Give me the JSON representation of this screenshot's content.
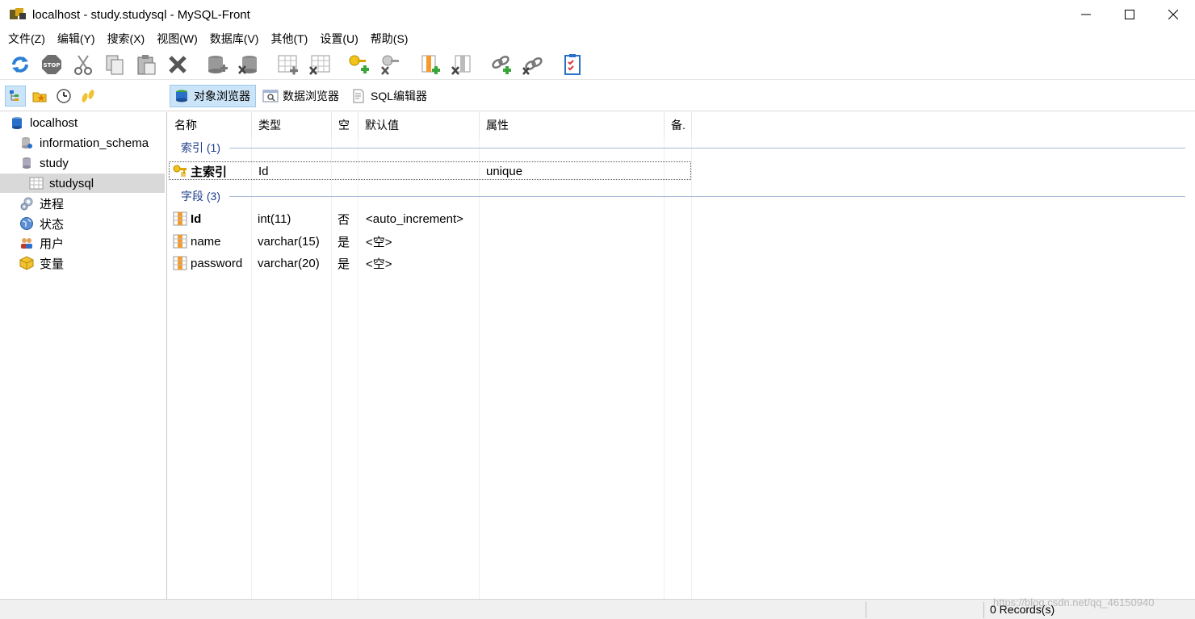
{
  "window": {
    "title": "localhost - study.studysql - MySQL-Front",
    "minimize": "—",
    "maximize": "☐",
    "close": "✕"
  },
  "menu": [
    "文件(Z)",
    "编辑(Y)",
    "搜索(X)",
    "视图(W)",
    "数据库(V)",
    "其他(T)",
    "设置(U)",
    "帮助(S)"
  ],
  "toolbar": {
    "icons": [
      "refresh-icon",
      "stop-icon",
      "cut-icon",
      "copy-icon",
      "paste-icon",
      "delete-icon",
      "new-database-icon",
      "delete-database-icon",
      "new-table-icon",
      "delete-table-icon",
      "new-index-icon",
      "delete-index-icon",
      "new-field-icon",
      "delete-field-icon",
      "new-foreign-key-icon",
      "delete-foreign-key-icon",
      "properties-icon"
    ]
  },
  "view_tabs": [
    "对象浏览器",
    "数据浏览器",
    "SQL编辑器"
  ],
  "tree": {
    "items": [
      "localhost",
      "information_schema",
      "study",
      "studysql",
      "进程",
      "状态",
      "用户",
      "变量"
    ]
  },
  "grid": {
    "headers": [
      "名称",
      "类型",
      "空",
      "默认值",
      "属性",
      "备."
    ],
    "index_group": "索引 (1)",
    "index_rows": [
      {
        "name": "主索引",
        "type": "Id",
        "null": "",
        "default": "",
        "attr": "unique"
      }
    ],
    "field_group": "字段 (3)",
    "field_rows": [
      {
        "name": "Id",
        "type": "int(11)",
        "null": "否",
        "default": "<auto_increment>"
      },
      {
        "name": "name",
        "type": "varchar(15)",
        "null": "是",
        "default": "<空>"
      },
      {
        "name": "password",
        "type": "varchar(20)",
        "null": "是",
        "default": "<空>"
      }
    ]
  },
  "status": {
    "records": "0 Records(s)",
    "watermark": "https://blog.csdn.net/qq_46150940"
  },
  "colors": {
    "accent": "#cce4f7",
    "group_text": "#1e3f8a"
  }
}
